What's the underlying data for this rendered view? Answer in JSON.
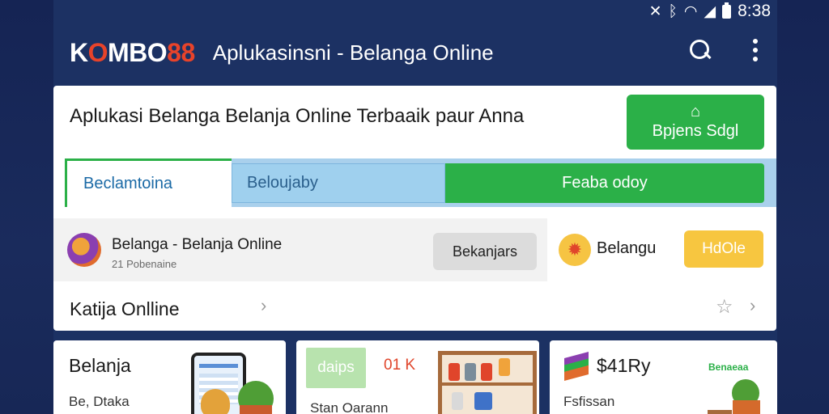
{
  "status_bar": {
    "time": "8:38",
    "icons": [
      "mute-icon",
      "bluetooth-icon",
      "wifi-icon",
      "signal-icon",
      "battery-icon"
    ]
  },
  "app_bar": {
    "logo_white": "K",
    "logo_white_2": "MBO",
    "logo_red_o": "O",
    "logo_red_num": "88",
    "title": "Aplukasinsni - Belanga Online"
  },
  "main": {
    "headline": "Aplukasi Belanga Belanja Online Terbaaik paur Anna",
    "cta_label": "Bpjens Sdgl",
    "tabs": [
      {
        "label": "Beclamtoina"
      },
      {
        "label": "Beloujaby"
      },
      {
        "label": "Feaba odoy"
      }
    ],
    "row": {
      "title": "Belanga - Belanja Online",
      "subtitle": "21 Pobenaine",
      "button_label": "Bekanjars"
    },
    "side_label": "Belangu",
    "yellow_button_label": "HdOle",
    "section_title": "Katija Onlline"
  },
  "cards": [
    {
      "title": "Belanja",
      "subtitle": "Be, Dtaka"
    },
    {
      "chip": "daips",
      "price": "01 K",
      "subtitle": "Stan Oarann"
    },
    {
      "title": "$41Ry",
      "tag": "Benaeaa",
      "subtitle": "Fsfissan"
    }
  ],
  "colors": {
    "navy": "#1c3163",
    "green": "#2bb048",
    "light_blue": "#a9d0ec",
    "yellow": "#f7c640",
    "brand_red": "#e8432a"
  }
}
